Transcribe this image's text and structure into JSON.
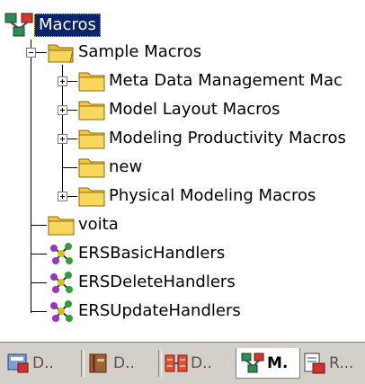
{
  "tree": {
    "root": {
      "label": "Macros",
      "icon": "macros-tree-icon",
      "selected": true
    },
    "sample_macros": {
      "label": "Sample Macros",
      "icon": "folder-open-icon",
      "expanded": true
    },
    "children": [
      {
        "label": "Meta Data Management Mac",
        "icon": "folder-icon",
        "expander": "plus"
      },
      {
        "label": "Model Layout Macros",
        "icon": "folder-icon",
        "expander": "plus"
      },
      {
        "label": "Modeling Productivity Macros",
        "icon": "folder-icon",
        "expander": "plus"
      },
      {
        "label": "new",
        "icon": "folder-icon",
        "expander": "none"
      },
      {
        "label": "Physical Modeling Macros",
        "icon": "folder-icon",
        "expander": "plus"
      }
    ],
    "voita": {
      "label": "voita",
      "icon": "folder-icon"
    },
    "handlers": [
      {
        "label": "ERSBasicHandlers",
        "icon": "handler-molecule-icon"
      },
      {
        "label": "ERSDeleteHandlers",
        "icon": "handler-molecule-icon"
      },
      {
        "label": "ERSUpdateHandlers",
        "icon": "handler-molecule-icon"
      }
    ]
  },
  "taskbar": {
    "tabs": [
      {
        "label": "D..",
        "icon": "data-dictionary-icon",
        "active": false
      },
      {
        "label": "D..",
        "icon": "database-book-icon",
        "active": false
      },
      {
        "label": "D..",
        "icon": "diagram-compare-icon",
        "active": false
      },
      {
        "label": "M.",
        "icon": "macros-tree-icon",
        "active": true
      },
      {
        "label": "R...",
        "icon": "report-icon",
        "active": false
      }
    ]
  },
  "colors": {
    "selection_bg": "#0a246a",
    "selection_text": "#ffffff",
    "folder_yellow": "#f6c73e",
    "taskbar_bg": "#d4d0c8",
    "tree_line": "#000000"
  }
}
